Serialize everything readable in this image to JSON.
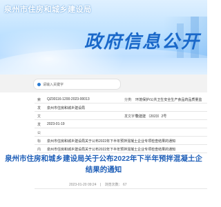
{
  "header": {
    "site_title": "泉州市住房和城乡建设局",
    "section_title": "政府信息公开"
  },
  "breadcrumb": {
    "placeholder": "请输入关键字"
  },
  "meta": {
    "rows": [
      {
        "label": "索",
        "value": "QZ00116-1200-2023-00013",
        "label2": "分类:",
        "value2": "环境保护/公共卫生安全生产食品药品质量监"
      },
      {
        "label": "发",
        "value": "泉州市住房和城乡建设局",
        "label2": "",
        "value2": ""
      },
      {
        "label": "文",
        "value": "",
        "label2": "发文字号:",
        "value2": "泉建建 〔2023〕2号"
      },
      {
        "label": "发",
        "value": "2023-01-19",
        "label2": "",
        "value2": ""
      },
      {
        "label": "公",
        "value": "",
        "label2": "",
        "value2": ""
      },
      {
        "label": "标",
        "value": "泉州市住房和城乡建设局关于公布2022年下半年预拌混凝土企业专项检查结果的通知",
        "label2": "",
        "value2": ""
      },
      {
        "label": "内",
        "value": "泉州市住房和城乡建设局关于公布2022年下半年预拌混凝土企业专项检查结果的通知",
        "label2": "",
        "value2": ""
      }
    ]
  },
  "article": {
    "title_line1": "泉州市住房和城乡建设局关于公布2022年下半年预拌混凝土企",
    "title_line2": "结果的通知",
    "browse_label": "浏览次数：",
    "date": "2023-01-20 09:24",
    "views": "67"
  }
}
